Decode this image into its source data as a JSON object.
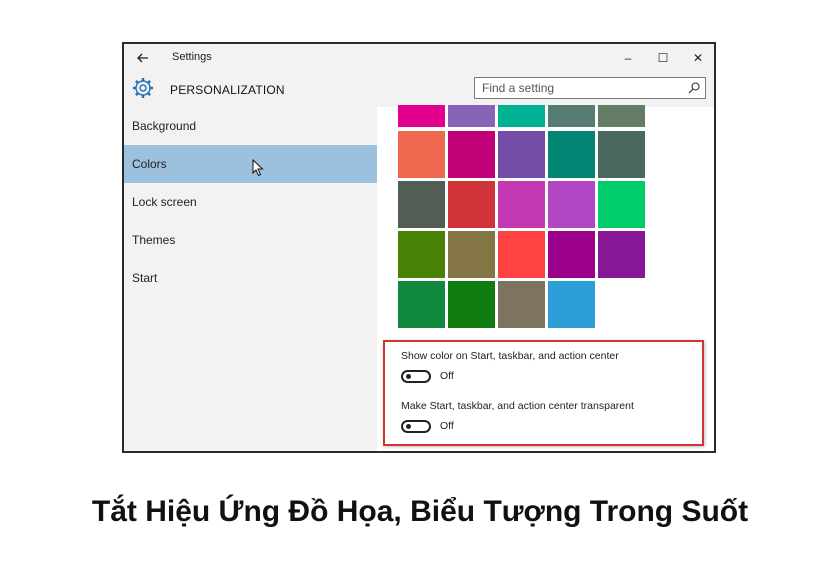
{
  "window": {
    "title": "Settings",
    "controls": {
      "minimize": "–",
      "maximize": "☐",
      "close": "✕"
    }
  },
  "header": {
    "section_title": "PERSONALIZATION",
    "search": {
      "placeholder": "Find a setting"
    }
  },
  "sidebar": {
    "items": [
      {
        "label": "Background",
        "active": false
      },
      {
        "label": "Colors",
        "active": true
      },
      {
        "label": "Lock screen",
        "active": false
      },
      {
        "label": "Themes",
        "active": false
      },
      {
        "label": "Start",
        "active": false
      }
    ]
  },
  "colors": {
    "rows": [
      [
        "#e3008c",
        "#8764b8",
        "#00b294",
        "#567c73",
        "#647c64"
      ],
      [
        "#ef6950",
        "#bf0077",
        "#744da9",
        "#018574",
        "#486860"
      ],
      [
        "#525e54",
        "#d13438",
        "#c239b3",
        "#b146c2",
        "#00cc6a"
      ],
      [
        "#498205",
        "#847545",
        "#ff4343",
        "#9a0089",
        "#881798"
      ],
      [
        "#10893e",
        "#107c10",
        "#7e735f",
        "#2d9fd8"
      ]
    ]
  },
  "options": {
    "show_color": {
      "label": "Show color on Start, taskbar, and action center",
      "state": "Off"
    },
    "transparent": {
      "label": "Make Start, taskbar, and action center transparent",
      "state": "Off"
    }
  },
  "caption": "Tắt Hiệu Ứng Đồ Họa, Biểu Tượng Trong Suốt"
}
